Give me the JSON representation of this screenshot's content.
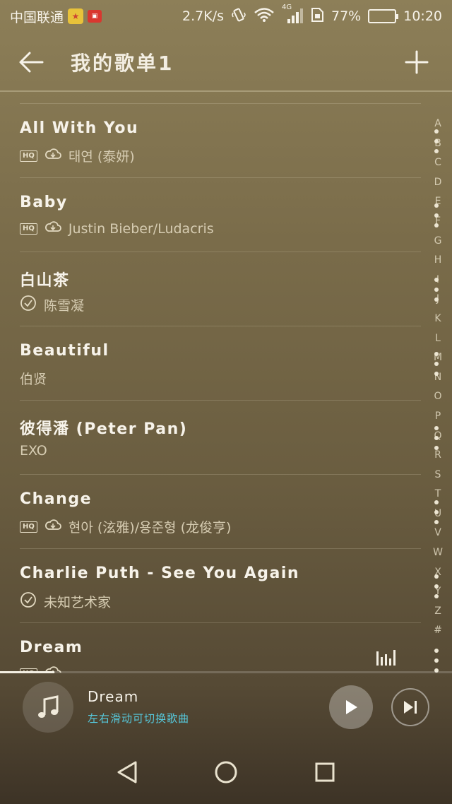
{
  "status_bar": {
    "carrier": "中国联通",
    "speed": "2.7K/s",
    "network": "4G",
    "battery_percent": "77%",
    "battery_level": 0.77,
    "time": "10:20"
  },
  "header": {
    "title": "我的歌单1"
  },
  "songs": [
    {
      "title": "All With You",
      "hq": "HQ",
      "artist": "태연 (泰妍)",
      "status": "cloud"
    },
    {
      "title": "Baby",
      "hq": "HQ",
      "artist": "Justin Bieber/Ludacris",
      "status": "cloud"
    },
    {
      "title": "白山茶",
      "artist": "陈雪凝",
      "status": "downloaded"
    },
    {
      "title": "Beautiful",
      "artist": "伯贤",
      "status": "none"
    },
    {
      "title": "彼得潘 (Peter Pan)",
      "artist": "EXO",
      "status": "none"
    },
    {
      "title": "Change",
      "hq": "HQ",
      "artist": "현아 (泫雅)/용준형 (龙俊亨)",
      "status": "cloud"
    },
    {
      "title": "Charlie Puth - See You Again",
      "artist": "未知艺术家",
      "status": "downloaded"
    },
    {
      "title": "Dream",
      "hq": "HQ",
      "artist": "",
      "status": "playing"
    }
  ],
  "alphabet_index": [
    "A",
    "B",
    "C",
    "D",
    "E",
    "F",
    "G",
    "H",
    "I",
    "J",
    "K",
    "L",
    "M",
    "N",
    "O",
    "P",
    "Q",
    "R",
    "S",
    "T",
    "U",
    "V",
    "W",
    "X",
    "Y",
    "Z",
    "#"
  ],
  "player": {
    "track": "Dream",
    "hint": "左右滑动可切换歌曲",
    "progress": 0.12
  },
  "colors": {
    "accent": "#56c9dd",
    "background_top": "#8d7f58",
    "background_bottom": "#3d3326"
  },
  "icons": {
    "back": "arrow-left-icon",
    "add": "plus-icon",
    "cloud": "cloud-download-icon",
    "downloaded": "check-circle-icon",
    "more": "vertical-dots-icon",
    "playing": "equalizer-icon",
    "cover": "music-note-icon",
    "play": "play-icon",
    "next": "skip-next-icon",
    "nav_back": "triangle-back-icon",
    "nav_home": "circle-home-icon",
    "nav_recent": "square-recent-icon"
  }
}
